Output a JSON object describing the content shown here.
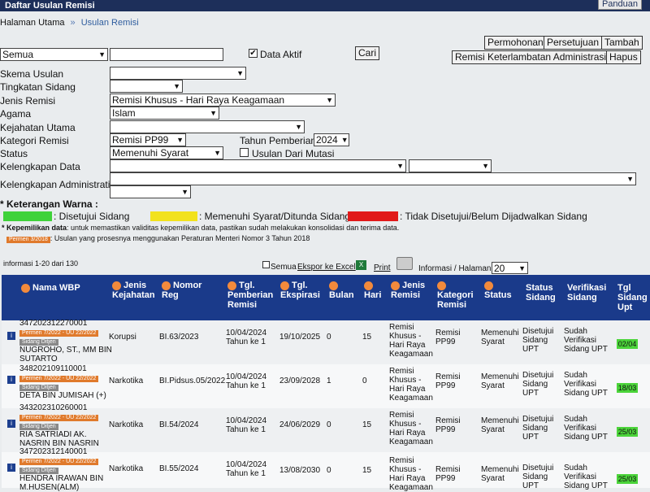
{
  "window": {
    "title": "Daftar Usulan Remisi",
    "help": "Panduan"
  },
  "breadcrumb": {
    "home": "Halaman Utama",
    "sep": "»",
    "current": "Usulan Remisi"
  },
  "toolbar": {
    "filter_select": "Semua",
    "data_aktif_label": "Data Aktif",
    "cari": "Cari",
    "permohonan": "Permohonan",
    "persetujuan": "Persetujuan",
    "tambah": "Tambah",
    "remisi_keterlambatan": "Remisi Keterlambatan Administrasi",
    "hapus": "Hapus"
  },
  "form": {
    "skema_usulan": {
      "label": "Skema Usulan",
      "value": ""
    },
    "tingkatan_sidang": {
      "label": "Tingkatan Sidang",
      "value": ""
    },
    "jenis_remisi": {
      "label": "Jenis Remisi",
      "value": "Remisi Khusus - Hari Raya Keagamaan"
    },
    "agama": {
      "label": "Agama",
      "value": "Islam"
    },
    "kejahatan_utama": {
      "label": "Kejahatan Utama",
      "value": ""
    },
    "kategori_remisi": {
      "label": "Kategori Remisi",
      "value": "Remisi PP99"
    },
    "tahun_pemberian": {
      "label": "Tahun Pemberian",
      "value": "2024"
    },
    "status": {
      "label": "Status",
      "value": "Memenuhi Syarat"
    },
    "usulan_dari_mutasi": "Usulan Dari Mutasi",
    "kelengkapan_data": {
      "label": "Kelengkapan Data"
    },
    "kelengkapan_administratif": {
      "label": "Kelengkapan Administratif"
    }
  },
  "legend": {
    "title": "* Keterangan Warna :",
    "green_label": ": Disetujui Sidang",
    "yellow_label": ": Memenuhi Syarat/Ditunda Sidang",
    "red_label": ": Tidak Disetujui/Belum Dijadwalkan Sidang",
    "green_color": "#3fd23a",
    "yellow_color": "#f2e21d",
    "red_color": "#e11a1a",
    "note1_prefix": "* Kepemilikan data",
    "note1": ": untuk memastikan validitas kepemilikan data, pastikan sudah melakukan konsolidasi dan terima data.",
    "note2_badge": "Permen 3/2018",
    "note2": ": Usulan yang prosesnya menggunakan Peraturan Menteri Nomor 3 Tahun 2018"
  },
  "list_controls": {
    "info": "informasi 1-20 dari 130",
    "semua": "Semua",
    "ekspor": "Ekspor ke Excel",
    "print": "Print",
    "per_page_label": "Informasi / Halaman",
    "per_page": "20"
  },
  "table": {
    "headers": [
      "Nama WBP",
      "Jenis Kejahatan",
      "Nomor Reg",
      "Tgl. Pemberian Remisi",
      "Tgl. Ekspirasi",
      "Bulan",
      "Hari",
      "Jenis Remisi",
      "Kategori Remisi",
      "Status",
      "Status Sidang",
      "Verifikasi Sidang",
      "Tgl Sidang Upt"
    ],
    "rows": [
      {
        "id": "347202312270001",
        "badge1": "Permen 7/2022 - UU 22/2022",
        "badge2": "Sidang Ditjen",
        "name": "NUGROHO, ST., MM BIN SUTARTO",
        "kejahatan": "Korupsi",
        "reg": "BI.63/2023",
        "tgl_pemberian": "10/04/2024 Tahun ke 1",
        "tgl_ekspirasi": "19/10/2025",
        "bulan": "0",
        "hari": "15",
        "jenis": "Remisi Khusus - Hari Raya Keagamaan",
        "kategori": "Remisi PP99",
        "status": "Memenuhi Syarat",
        "status_sidang": "Disetujui Sidang UPT",
        "verifikasi": "Sudah Verifikasi Sidang UPT",
        "tgl_sidang": "02/04"
      },
      {
        "id": "348202109110001",
        "badge1": "Permen 7/2022 - UU 22/2022",
        "badge2": "Sidang Ditjen",
        "name": "DETA BIN JUMISAH (+)",
        "kejahatan": "Narkotika",
        "reg": "BI.Pidsus.05/2022",
        "tgl_pemberian": "10/04/2024 Tahun ke 1",
        "tgl_ekspirasi": "23/09/2028",
        "bulan": "1",
        "hari": "0",
        "jenis": "Remisi Khusus - Hari Raya Keagamaan",
        "kategori": "Remisi PP99",
        "status": "Memenuhi Syarat",
        "status_sidang": "Disetujui Sidang UPT",
        "verifikasi": "Sudah Verifikasi Sidang UPT",
        "tgl_sidang": "18/03"
      },
      {
        "id": "343202310260001",
        "badge1": "Permen 7/2022 - UU 22/2022",
        "badge2": "Sidang Ditjen",
        "name": "RIA SATRIADI AK. NASRIN BIN NASRIN",
        "kejahatan": "Narkotika",
        "reg": "BI.54/2024",
        "tgl_pemberian": "10/04/2024 Tahun ke 1",
        "tgl_ekspirasi": "24/06/2029",
        "bulan": "0",
        "hari": "15",
        "jenis": "Remisi Khusus - Hari Raya Keagamaan",
        "kategori": "Remisi PP99",
        "status": "Memenuhi Syarat",
        "status_sidang": "Disetujui Sidang UPT",
        "verifikasi": "Sudah Verifikasi Sidang UPT",
        "tgl_sidang": "25/03"
      },
      {
        "id": "347202312140001",
        "badge1": "Permen 7/2022 - UU 22/2022",
        "badge2": "Sidang Ditjen",
        "name": "HENDRA IRAWAN BIN M.HUSEN(ALM)",
        "kejahatan": "Narkotika",
        "reg": "BI.55/2024",
        "tgl_pemberian": "10/04/2024 Tahun ke 1",
        "tgl_ekspirasi": "13/08/2030",
        "bulan": "0",
        "hari": "15",
        "jenis": "Remisi Khusus - Hari Raya Keagamaan",
        "kategori": "Remisi PP99",
        "status": "Memenuhi Syarat",
        "status_sidang": "Disetujui Sidang UPT",
        "verifikasi": "Sudah Verifikasi Sidang UPT",
        "tgl_sidang": "25/03"
      }
    ]
  }
}
